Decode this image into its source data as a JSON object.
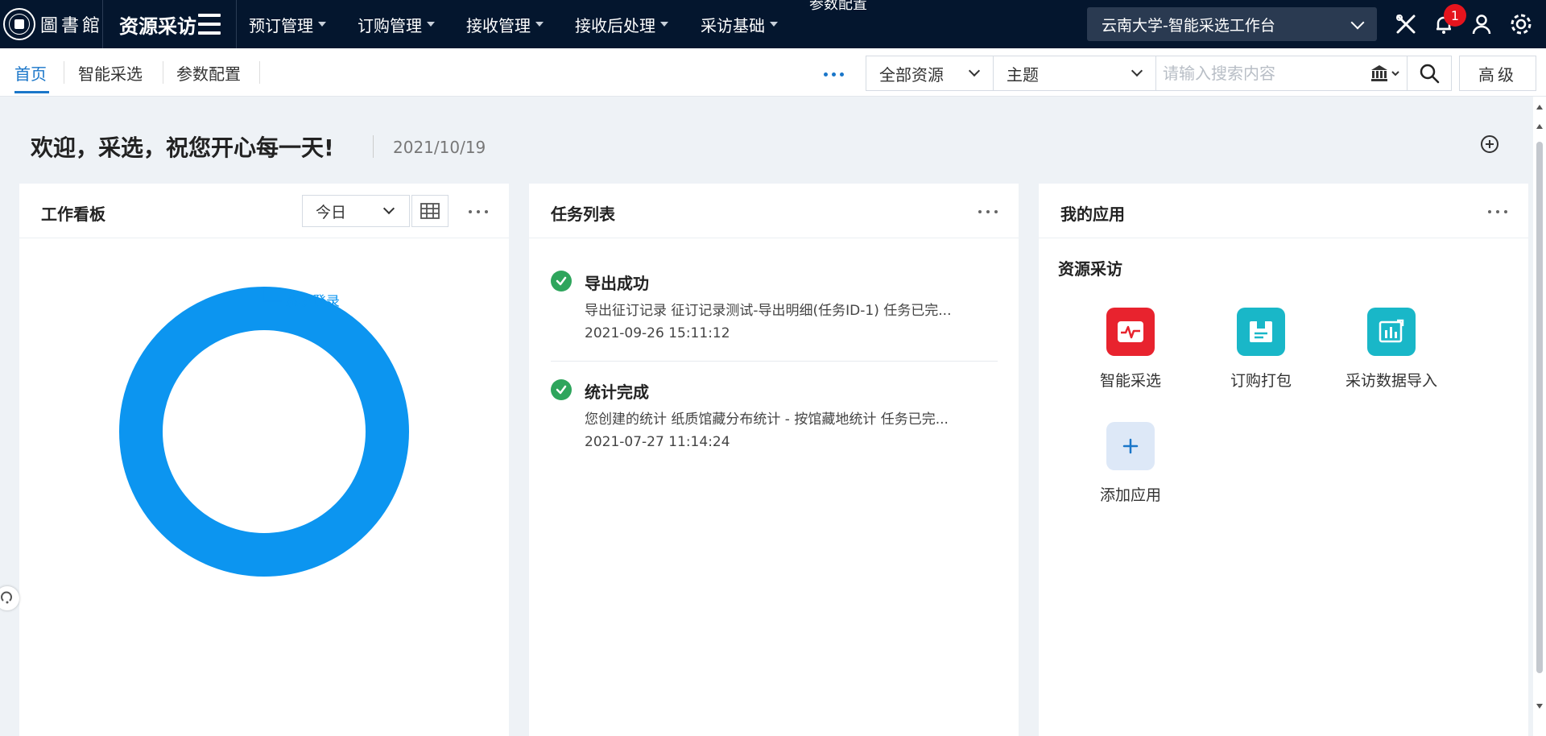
{
  "topbar": {
    "logo_text": "圖書館",
    "app_title": "资源采访",
    "menu": [
      {
        "label": "预订管理"
      },
      {
        "label": "订购管理"
      },
      {
        "label": "接收管理"
      },
      {
        "label": "接收后处理"
      },
      {
        "label": "采访基础"
      }
    ],
    "floating_label": "参数配置",
    "workbench": "云南大学-智能采选工作台",
    "notification_count": "1",
    "bg_color": "#04162e"
  },
  "subnav": {
    "tabs": [
      {
        "label": "首页",
        "active": true
      },
      {
        "label": "智能采选",
        "active": false
      },
      {
        "label": "参数配置",
        "active": false
      }
    ],
    "scope_select": "全部资源",
    "field_select": "主题",
    "search_placeholder": "请输入搜索内容",
    "advanced_label": "高级"
  },
  "welcome": {
    "greeting": "欢迎，采选，祝您开心每一天!",
    "date": "2021/10/19"
  },
  "dashboard": {
    "title": "工作看板",
    "period": "今日",
    "chart_data": {
      "type": "pie",
      "categories": [
        "系统登录"
      ],
      "values": [
        1
      ],
      "colors": [
        "#0c95f0"
      ]
    }
  },
  "tasks": {
    "title": "任务列表",
    "items": [
      {
        "title": "导出成功",
        "desc": "导出征订记录 征订记录测试-导出明细(任务ID-1) 任务已完...",
        "time": "2021-09-26 15:11:12"
      },
      {
        "title": "统计完成",
        "desc": "您创建的统计 纸质馆藏分布统计 - 按馆藏地统计 任务已完...",
        "time": "2021-07-27 11:14:24"
      }
    ]
  },
  "apps": {
    "title": "我的应用",
    "group": "资源采访",
    "items": [
      {
        "label": "智能采选",
        "icon": "pulse-icon",
        "color": "#e8232e"
      },
      {
        "label": "订购打包",
        "icon": "package-icon",
        "color": "#19b7c8"
      },
      {
        "label": "采访数据导入",
        "icon": "data-import-icon",
        "color": "#19b7c8"
      }
    ],
    "add_label": "添加应用"
  }
}
